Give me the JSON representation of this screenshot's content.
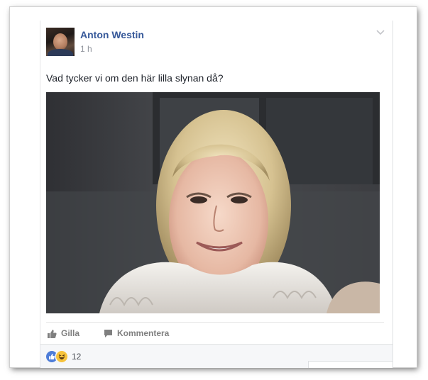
{
  "post": {
    "author": "Anton Westin",
    "timestamp": "1 h",
    "text": "Vad tycker vi om den här lilla slynan då?",
    "menu_icon": "chevron-down-icon"
  },
  "actions": {
    "like_label": "Gilla",
    "comment_label": "Kommentera",
    "like_icon": "thumbs-up-icon",
    "comment_icon": "speech-bubble-icon"
  },
  "reactions": {
    "types": [
      "like",
      "haha"
    ],
    "count": "12"
  },
  "colors": {
    "author": "#365899",
    "like_reaction": "#4e7dd8",
    "haha_reaction": "#f7c33c",
    "action_text": "#7f7f7f"
  }
}
